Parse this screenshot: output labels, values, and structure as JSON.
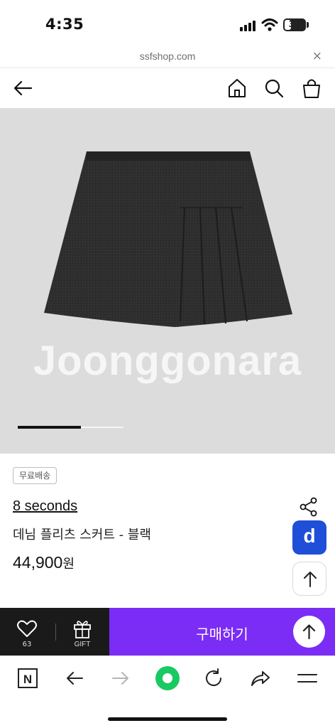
{
  "status_bar": {
    "time": "4:35",
    "battery": "33",
    "battery_level": 0.33
  },
  "browser": {
    "url": "ssfshop.com",
    "close_glyph": "×"
  },
  "header": {
    "back_icon": "arrow-left-icon",
    "home_icon": "home-icon",
    "search_icon": "search-icon",
    "cart_icon": "shopping-bag-icon"
  },
  "gallery": {
    "watermark": "Joonggonara",
    "progress": 0.6,
    "background_color": "#dcdcdc"
  },
  "product": {
    "shipping_badge": "무료배송",
    "brand": "8 seconds",
    "name": "데님 플리츠 스커트 - 블랙",
    "price": "44,900",
    "currency": "원"
  },
  "side_buttons": {
    "share_icon": "share-icon",
    "d_badge": "d",
    "scroll_top_icon": "arrow-up-icon"
  },
  "purchase_bar": {
    "like_count": "63",
    "gift_label": "GIFT",
    "buy_label": "구매하기",
    "accent_color": "#7b2cf5"
  },
  "browser_toolbar": {
    "n_icon": "N",
    "items": [
      "back-icon",
      "forward-icon",
      "green-dot-icon",
      "refresh-icon",
      "share-icon",
      "menu-icon"
    ],
    "accent_color": "#1ac964"
  }
}
